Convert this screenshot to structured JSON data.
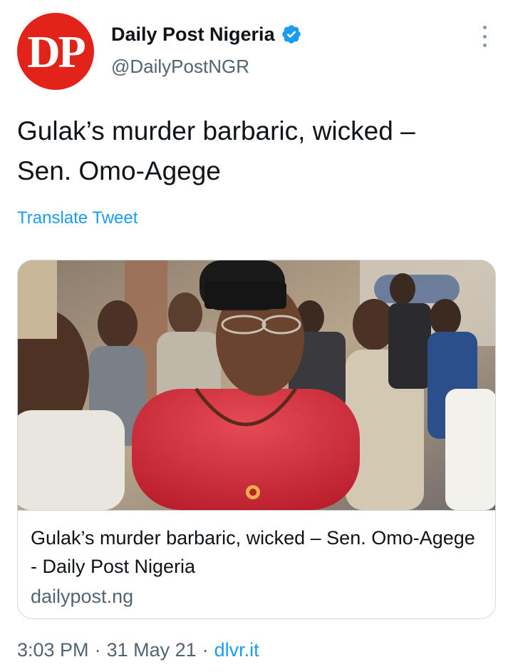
{
  "user": {
    "display_name": "Daily Post Nigeria",
    "handle": "@DailyPostNGR",
    "avatar_text": "DP",
    "verified": true,
    "avatar_color": "#e2231a"
  },
  "tweet": {
    "text": "Gulak’s murder barbaric, wicked –\nSen. Omo-Agege",
    "translate_label": "Translate Tweet"
  },
  "card": {
    "image_alt": "Photo of a man in a red outfit and black cap among people",
    "title": "Gulak’s murder barbaric, wicked – Sen. Omo-Agege - Daily Post Nigeria",
    "domain": "dailypost.ng"
  },
  "meta": {
    "time": "3:03 PM",
    "sep1": "·",
    "date": "31 May 21",
    "sep2": "·",
    "source": "dlvr.it"
  },
  "colors": {
    "link_blue": "#1d9bf0",
    "secondary_text": "#536471",
    "border": "#cfd9de"
  },
  "icons": {
    "verified": "verified-badge-icon",
    "more": "more-options-icon"
  }
}
